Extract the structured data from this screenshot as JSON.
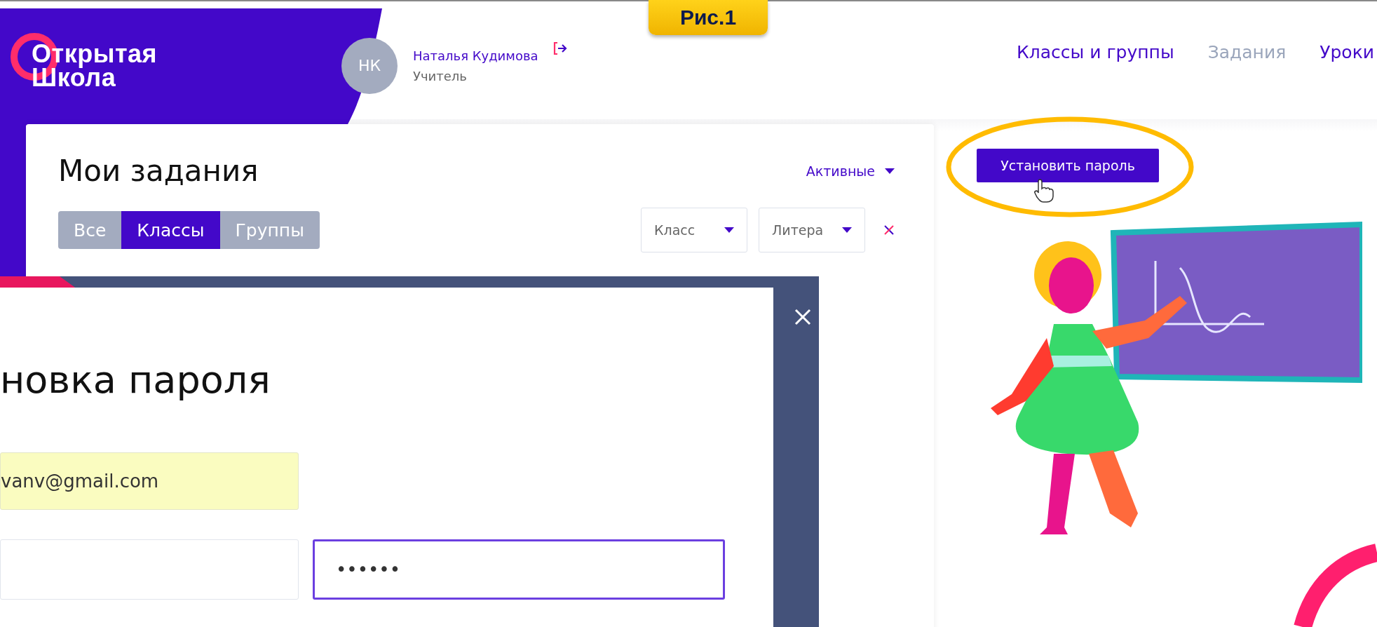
{
  "figure_label": "Рис.1",
  "logo": {
    "line1": "Открытая",
    "line2": "Школа"
  },
  "user": {
    "initials": "НК",
    "name": "Наталья Кудимова",
    "role": "Учитель"
  },
  "nav": [
    {
      "label": "Классы и группы",
      "selected": false
    },
    {
      "label": "Задания",
      "selected": true
    },
    {
      "label": "Уроки",
      "selected": false
    }
  ],
  "tasks": {
    "title": "Мои задания",
    "status_filter": "Активные",
    "tabs": [
      {
        "label": "Все",
        "selected": false
      },
      {
        "label": "Классы",
        "selected": true
      },
      {
        "label": "Группы",
        "selected": false
      }
    ],
    "selects": [
      {
        "label": "Класс"
      },
      {
        "label": "Литера"
      }
    ]
  },
  "set_password_button": "Установить пароль",
  "modal": {
    "title": "новка пароля",
    "email": "vanv@gmail.com",
    "password": "••••••"
  }
}
